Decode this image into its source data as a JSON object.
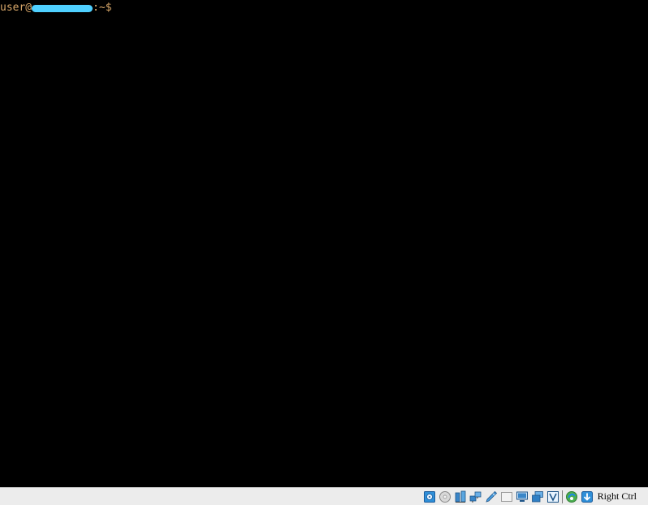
{
  "terminal": {
    "prompt_user": "user@",
    "prompt_suffix": ":~$",
    "prompt_color": "#d9a86a",
    "redaction_color": "#4fd0ff"
  },
  "statusbar": {
    "icons": [
      "hard-disk-icon",
      "optical-drive-icon",
      "audio-icon",
      "network-icon",
      "usb-icon",
      "shared-folder-icon",
      "display-icon",
      "video-capture-icon",
      "virtualization-icon",
      "mouse-integration-icon",
      "keyboard-capture-icon"
    ],
    "host_key_label": "Right Ctrl"
  }
}
